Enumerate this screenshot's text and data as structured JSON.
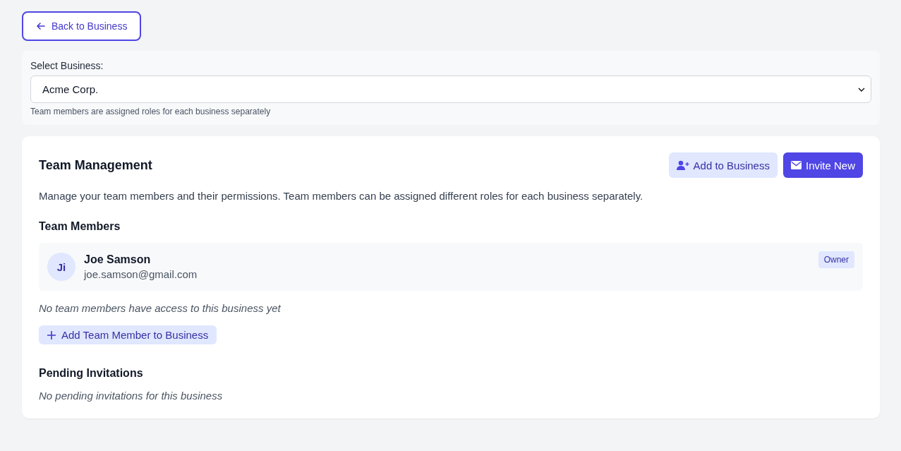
{
  "back_button": {
    "label": "Back to Business"
  },
  "business_select": {
    "label": "Select Business:",
    "value": "Acme Corp.",
    "hint": "Team members are assigned roles for each business separately"
  },
  "team_management": {
    "title": "Team Management",
    "actions": [
      {
        "kind": "secondary",
        "label": "Add to Business"
      },
      {
        "kind": "primary",
        "label": "Invite New"
      }
    ],
    "description": "Manage your team members and their permissions. Team members can be assigned different roles for each business separately.",
    "members_heading": "Team Members",
    "members": [
      {
        "initials": "Ji",
        "name": "Joe Samson",
        "email": "joe.samson@gmail.com",
        "role": "Owner"
      }
    ],
    "empty_members": "No team members have access to this business yet",
    "add_member_button": "Add Team Member to Business",
    "invitations_heading": "Pending Invitations",
    "empty_invitations": "No pending invitations for this business"
  }
}
